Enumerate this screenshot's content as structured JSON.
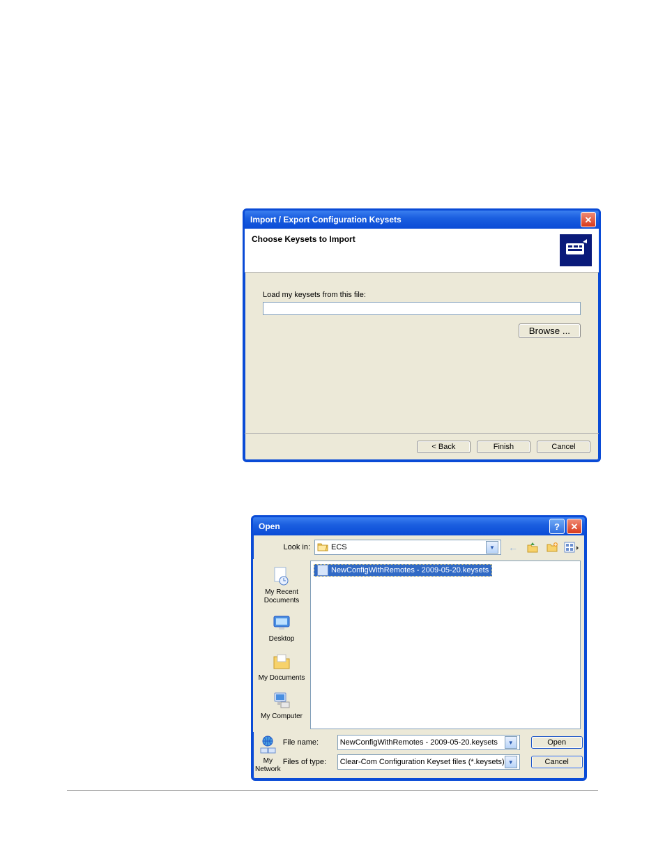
{
  "dialog1": {
    "title": "Import / Export Configuration Keysets",
    "heading": "Choose Keysets to Import",
    "bodyLabel": "Load my keysets from this file:",
    "fileValue": "",
    "browse": "Browse ...",
    "back": "< Back",
    "finish": "Finish",
    "cancel": "Cancel"
  },
  "dialog2": {
    "title": "Open",
    "lookInLabel": "Look in:",
    "lookInValue": "ECS",
    "navIcons": {
      "back": "back-icon",
      "up": "up-one-level-icon",
      "newFolder": "create-new-folder-icon",
      "views": "views-menu-icon"
    },
    "places": [
      {
        "label": "My Recent Documents",
        "iconName": "recent-docs-icon"
      },
      {
        "label": "Desktop",
        "iconName": "desktop-icon"
      },
      {
        "label": "My Documents",
        "iconName": "my-documents-icon"
      },
      {
        "label": "My Computer",
        "iconName": "my-computer-icon"
      },
      {
        "label": "My Network",
        "iconName": "my-network-icon"
      }
    ],
    "selectedFile": "NewConfigWithRemotes - 2009-05-20.keysets",
    "fileNameLabel": "File name:",
    "fileNameValue": "NewConfigWithRemotes - 2009-05-20.keysets",
    "fileTypeLabel": "Files of type:",
    "fileTypeValue": "Clear-Com Configuration Keyset files (*.keysets)",
    "open": "Open",
    "cancel": "Cancel"
  }
}
